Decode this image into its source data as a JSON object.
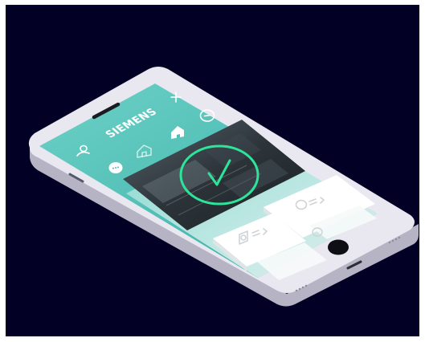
{
  "app": {
    "brand": "SIEMENS"
  },
  "colors": {
    "background": "#020024",
    "accent_teal": "#58c8bf",
    "confirm_ring": "#2ee39a",
    "device_body": "#e9e8f1",
    "card": "#ffffff"
  },
  "toolbar": {
    "add_icon": "plus-icon",
    "more_icon": "more-circle-icon"
  },
  "nav": {
    "items": [
      {
        "icon": "user-icon",
        "active": false
      },
      {
        "icon": "home-outline-icon",
        "active": false
      },
      {
        "icon": "home-filled-icon",
        "active": true
      }
    ],
    "chat_icon": "chat-bubble-icon"
  },
  "camera": {
    "status_icon": "check-circle-icon",
    "status": "confirmed"
  },
  "cards": [
    {
      "icon": "device-icon"
    },
    {
      "icon": "device-icon"
    }
  ]
}
